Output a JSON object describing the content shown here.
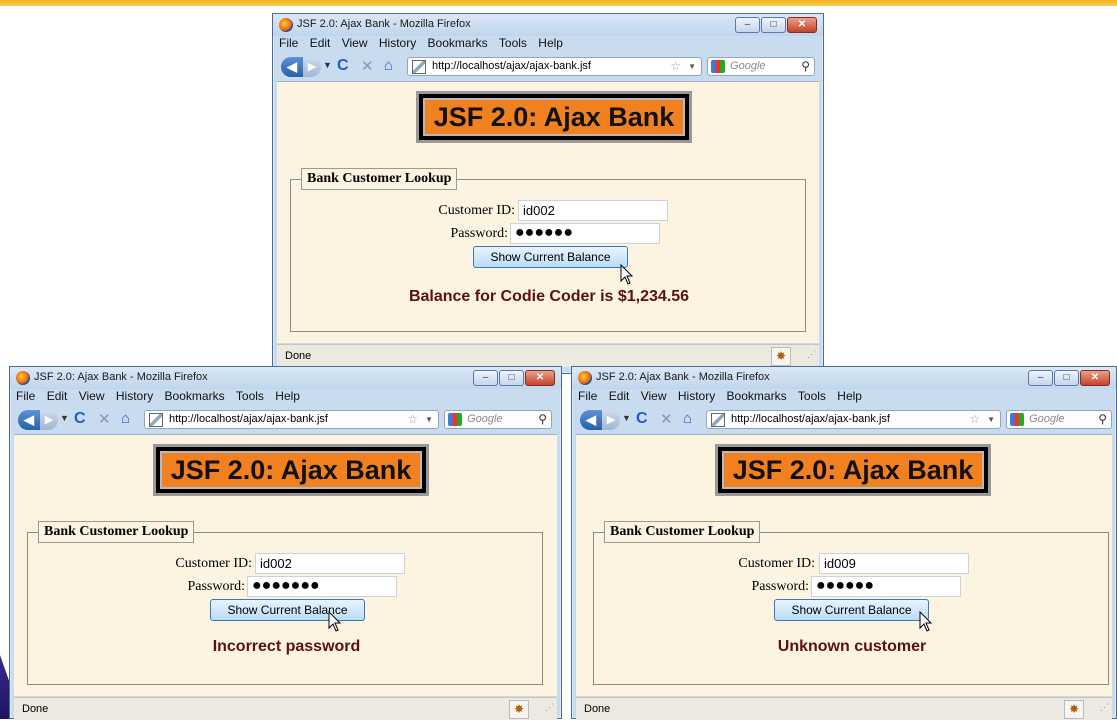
{
  "windows": [
    {
      "title": "JSF 2.0: Ajax Bank - Mozilla Firefox",
      "menu": [
        "File",
        "Edit",
        "View",
        "History",
        "Bookmarks",
        "Tools",
        "Help"
      ],
      "url": "http://localhost/ajax/ajax-bank.jsf",
      "search_placeholder": "Google",
      "banner": "JSF 2.0: Ajax Bank",
      "legend": "Bank Customer Lookup",
      "customer_id_label": "Customer ID:",
      "customer_id_value": "id002",
      "password_label": "Password:",
      "password_value": "●●●●●●",
      "button_label": "Show Current Balance",
      "result": "Balance for Codie Coder is $1,234.56",
      "status": "Done"
    },
    {
      "title": "JSF 2.0: Ajax Bank - Mozilla Firefox",
      "menu": [
        "File",
        "Edit",
        "View",
        "History",
        "Bookmarks",
        "Tools",
        "Help"
      ],
      "url": "http://localhost/ajax/ajax-bank.jsf",
      "search_placeholder": "Google",
      "banner": "JSF 2.0: Ajax Bank",
      "legend": "Bank Customer Lookup",
      "customer_id_label": "Customer ID:",
      "customer_id_value": "id002",
      "password_label": "Password:",
      "password_value": "●●●●●●●",
      "button_label": "Show Current Balance",
      "result": "Incorrect password",
      "status": "Done"
    },
    {
      "title": "JSF 2.0: Ajax Bank - Mozilla Firefox",
      "menu": [
        "File",
        "Edit",
        "View",
        "History",
        "Bookmarks",
        "Tools",
        "Help"
      ],
      "url": "http://localhost/ajax/ajax-bank.jsf",
      "search_placeholder": "Google",
      "banner": "JSF 2.0: Ajax Bank",
      "legend": "Bank Customer Lookup",
      "customer_id_label": "Customer ID:",
      "customer_id_value": "id009",
      "password_label": "Password:",
      "password_value": "●●●●●●",
      "button_label": "Show Current Balance",
      "result": "Unknown customer",
      "status": "Done"
    }
  ],
  "colors": {
    "banner_bg": "#f08020",
    "page_bg": "#fdf3e1",
    "result_text": "#5a1210",
    "button_bg": "#b9dcf5",
    "slide_accent": "#f2b21c"
  },
  "icons": [
    "firefox-icon",
    "back-icon",
    "forward-icon",
    "reload-icon",
    "stop-icon",
    "home-icon",
    "page-favicon",
    "bookmark-star-icon",
    "google-icon",
    "search-icon",
    "firebug-icon",
    "mouse-cursor-icon"
  ]
}
